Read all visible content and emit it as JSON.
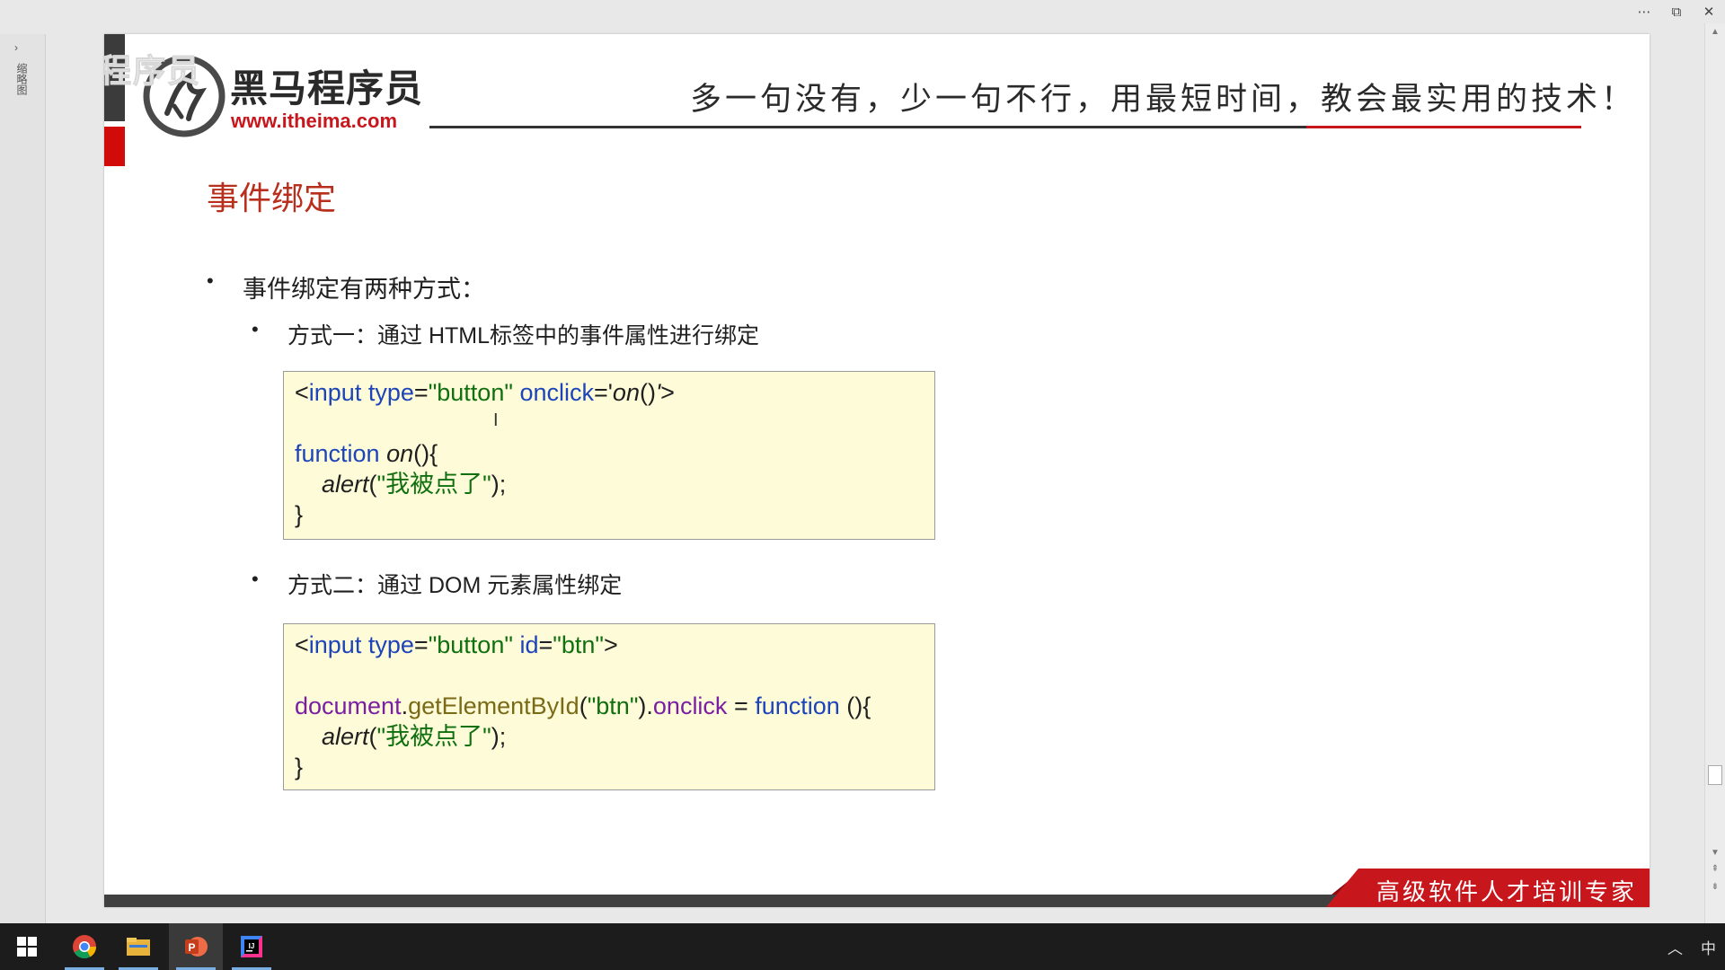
{
  "window": {
    "more_icon": "⋯",
    "restore_icon": "⧉",
    "close_icon": "✕",
    "pane_arrow": "›",
    "pane_label": "缩略图"
  },
  "slide": {
    "watermark": "黑马程序员",
    "logo_name": "黑马程序员",
    "logo_url": "www.itheima.com",
    "slogan": "多一句没有，少一句不行，用最短时间，教会最实用的技术！",
    "title": "事件绑定",
    "bullet_main": "事件绑定有两种方式：",
    "method1": "方式一：通过 HTML标签中的事件属性进行绑定",
    "method2": "方式二：通过 DOM 元素属性绑定",
    "badge": "高级软件人才培训专家",
    "bullet_glyph": "•",
    "text_cursor": "I"
  },
  "code1": [
    [
      [
        "<",
        "plain"
      ],
      [
        "input",
        "kw"
      ],
      [
        " ",
        "plain"
      ],
      [
        "type",
        "kw"
      ],
      [
        "=",
        "plain"
      ],
      [
        "\"button\"",
        "str"
      ],
      [
        " ",
        "plain"
      ],
      [
        "onclick",
        "kw"
      ],
      [
        "='",
        "plain"
      ],
      [
        "on",
        "it"
      ],
      [
        "()",
        "plain"
      ],
      [
        "'",
        "it"
      ],
      [
        ">",
        "plain"
      ]
    ],
    [],
    [
      [
        "function",
        "kw"
      ],
      [
        " ",
        "plain"
      ],
      [
        "on",
        "it"
      ],
      [
        "(){",
        "plain"
      ]
    ],
    [
      [
        "    ",
        "plain"
      ],
      [
        "alert",
        "it"
      ],
      [
        "(",
        "plain"
      ],
      [
        "\"我被点了\"",
        "str"
      ],
      [
        ");",
        "plain"
      ]
    ],
    [
      [
        "}",
        "plain"
      ]
    ]
  ],
  "code2": [
    [
      [
        "<",
        "plain"
      ],
      [
        "input",
        "kw"
      ],
      [
        " ",
        "plain"
      ],
      [
        "type",
        "kw"
      ],
      [
        "=",
        "plain"
      ],
      [
        "\"button\"",
        "str"
      ],
      [
        " ",
        "plain"
      ],
      [
        "id",
        "kw"
      ],
      [
        "=",
        "plain"
      ],
      [
        "\"btn\"",
        "str"
      ],
      [
        ">",
        "plain"
      ]
    ],
    [],
    [
      [
        "document",
        "obj"
      ],
      [
        ".",
        "plain"
      ],
      [
        "getElementById",
        "meth"
      ],
      [
        "(",
        "plain"
      ],
      [
        "\"btn\"",
        "str"
      ],
      [
        ").",
        "plain"
      ],
      [
        "onclick",
        "obj"
      ],
      [
        " = ",
        "plain"
      ],
      [
        "function",
        "kw"
      ],
      [
        " (){",
        "plain"
      ]
    ],
    [
      [
        "    ",
        "plain"
      ],
      [
        "alert",
        "it"
      ],
      [
        "(",
        "plain"
      ],
      [
        "\"我被点了\"",
        "str"
      ],
      [
        ");",
        "plain"
      ]
    ],
    [
      [
        "}",
        "plain"
      ]
    ]
  ],
  "taskbar": {
    "items": [
      {
        "name": "start-button",
        "icon": "windows-icon",
        "active": false
      },
      {
        "name": "chrome-app",
        "icon": "chrome-icon",
        "active": false
      },
      {
        "name": "file-explorer-app",
        "icon": "folder-icon",
        "active": false
      },
      {
        "name": "powerpoint-app",
        "icon": "powerpoint-icon",
        "active": true
      },
      {
        "name": "intellij-app",
        "icon": "intellij-icon",
        "active": false
      }
    ],
    "tray_chevron": "︿",
    "ime": "中"
  },
  "colors": {
    "accent_red": "#c8161d",
    "title_red": "#b8301d",
    "code_bg": "#fefbd9",
    "keyword": "#1d44b8",
    "string": "#107010"
  }
}
